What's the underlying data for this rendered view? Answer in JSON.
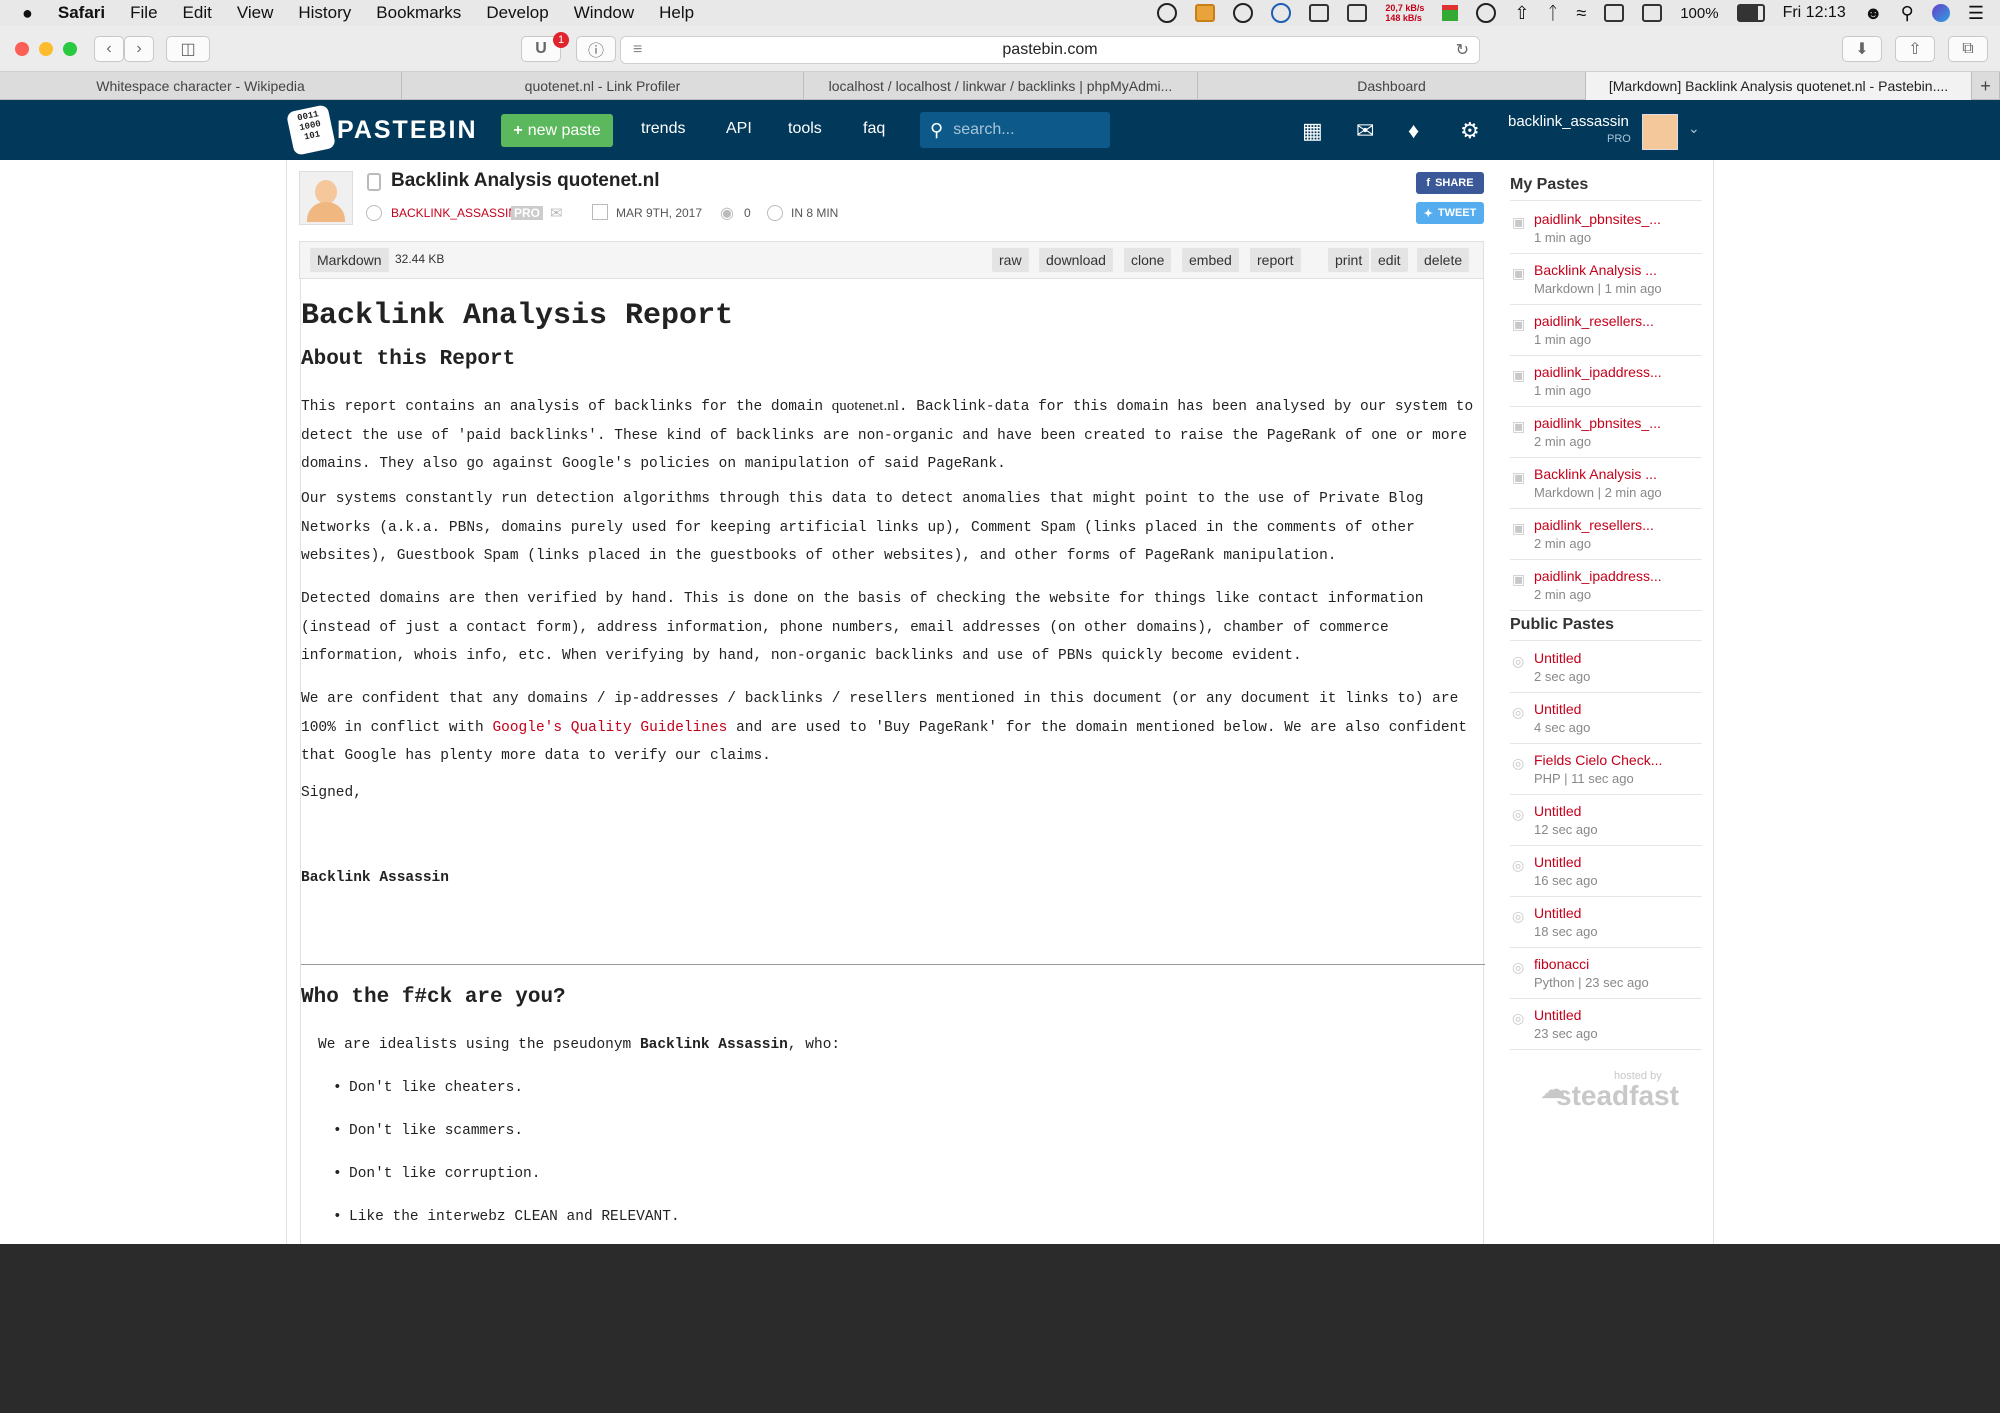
{
  "menubar": {
    "app": "Safari",
    "items": [
      "File",
      "Edit",
      "View",
      "History",
      "Bookmarks",
      "Develop",
      "Window",
      "Help"
    ],
    "net_up": "20,7 kB/s",
    "net_down": "148 kB/s",
    "battery": "100%",
    "clock": "Fri 12:13"
  },
  "browser": {
    "url": "pastebin.com",
    "tabs": [
      "Whitespace character - Wikipedia",
      "quotenet.nl - Link Profiler",
      "localhost / localhost / linkwar / backlinks | phpMyAdmi...",
      "Dashboard",
      "[Markdown] Backlink Analysis quotenet.nl - Pastebin...."
    ],
    "badge": "1"
  },
  "site": {
    "logo": "PASTEBIN",
    "new_paste": "new paste",
    "nav": [
      "trends",
      "API",
      "tools",
      "faq"
    ],
    "search_placeholder": "search...",
    "username": "backlink_assassin",
    "user_tier": "PRO"
  },
  "paste": {
    "title": "Backlink Analysis quotenet.nl",
    "author": "BACKLINK_ASSASSIN",
    "pro": "PRO",
    "date": "MAR 9TH, 2017",
    "views": "0",
    "expire": "IN 8 MIN",
    "share": "SHARE",
    "tweet": "TWEET",
    "syntax": "Markdown",
    "size": "32.44 KB",
    "actions": [
      "raw",
      "download",
      "clone",
      "embed",
      "report",
      "print",
      "edit",
      "delete"
    ]
  },
  "content": {
    "h1": "Backlink Analysis Report",
    "h2_about": "About this Report",
    "p1a": "This report contains an analysis of backlinks for the domain ",
    "p1_domain": "quotenet.nl",
    "p1b": ". Backlink-data for this domain has been analysed by our system to detect the use of 'paid backlinks'. These kind of backlinks are non-organic and have been created to raise the PageRank of one or more domains. They also go against Google's policies on manipulation of said PageRank.",
    "p2": "Our systems constantly run detection algorithms through this data to detect anomalies that might point to the use of Private Blog Networks (a.k.a. PBNs, domains purely used for keeping artificial links up), Comment Spam (links placed in the comments of other websites), Guestbook Spam (links placed in the guestbooks of other websites), and other forms of PageRank manipulation.",
    "p3": "Detected domains are then verified by hand. This is done on the basis of checking the website for things like contact information (instead of just a contact form), address information, phone numbers, email addresses (on other domains), chamber of commerce information, whois info, etc. When verifying by hand, non-organic backlinks and use of PBNs quickly become evident.",
    "p4a": "We are confident that any domains / ip-addresses / backlinks / resellers mentioned in this document (or any document it links to) are 100% in conflict with ",
    "p4_link": "Google's Quality Guidelines",
    "p4b": " and are used to 'Buy PageRank' for the domain mentioned below. We are also confident that Google has plenty more data to verify our claims.",
    "signed": "Signed,",
    "signature": "Backlink Assassin",
    "h2_who": "Who the f#ck are you?",
    "who_a": "We are idealists using the pseudonym ",
    "who_b": "Backlink Assassin",
    "who_c": ", who:",
    "bullets": [
      "Don't like cheaters.",
      "Don't like scammers.",
      "Don't like corruption.",
      "Like the interwebz CLEAN and RELEVANT."
    ]
  },
  "sidebar": {
    "my_title": "My Pastes",
    "my": [
      {
        "t": "paidlink_pbnsites_...",
        "s": "1 min ago"
      },
      {
        "t": "Backlink Analysis ...",
        "s": "Markdown | 1 min ago"
      },
      {
        "t": "paidlink_resellers...",
        "s": "1 min ago"
      },
      {
        "t": "paidlink_ipaddress...",
        "s": "1 min ago"
      },
      {
        "t": "paidlink_pbnsites_...",
        "s": "2 min ago"
      },
      {
        "t": "Backlink Analysis ...",
        "s": "Markdown | 2 min ago"
      },
      {
        "t": "paidlink_resellers...",
        "s": "2 min ago"
      },
      {
        "t": "paidlink_ipaddress...",
        "s": "2 min ago"
      }
    ],
    "public_title": "Public Pastes",
    "public": [
      {
        "t": "Untitled",
        "s": "2 sec ago"
      },
      {
        "t": "Untitled",
        "s": "4 sec ago"
      },
      {
        "t": "Fields Cielo Check...",
        "s": "PHP | 11 sec ago"
      },
      {
        "t": "Untitled",
        "s": "12 sec ago"
      },
      {
        "t": "Untitled",
        "s": "16 sec ago"
      },
      {
        "t": "Untitled",
        "s": "18 sec ago"
      },
      {
        "t": "fibonacci",
        "s": "Python | 23 sec ago"
      },
      {
        "t": "Untitled",
        "s": "23 sec ago"
      }
    ],
    "hosted_by": "hosted by",
    "host": "steadfast"
  }
}
